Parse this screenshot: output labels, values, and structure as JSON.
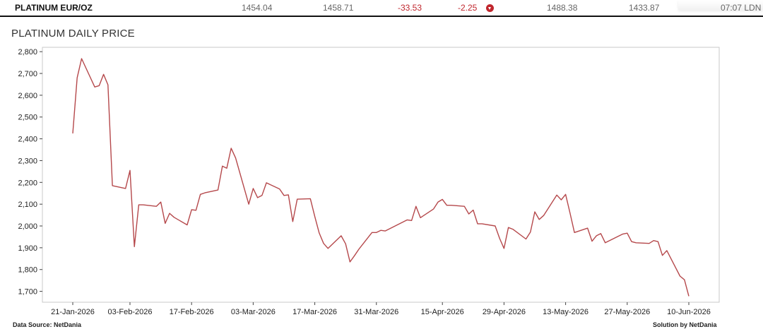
{
  "quote": {
    "name": "PLATINUM EUR/OZ",
    "last": "1454.04",
    "prev": "1458.71",
    "change": "-33.53",
    "change_pct": "-2.25",
    "direction_icon": "down-arrow-icon",
    "high": "1488.38",
    "low": "1433.87",
    "time": "07:07 LDN"
  },
  "chart_data": {
    "type": "line",
    "title": "PLATINUM DAILY PRICE",
    "xlabel": "",
    "ylabel": "",
    "ylim": [
      1650,
      2820
    ],
    "yticks": [
      1700,
      1800,
      1900,
      2000,
      2100,
      2200,
      2300,
      2400,
      2500,
      2600,
      2700,
      2800
    ],
    "ytick_labels": [
      "1,700",
      "1,800",
      "1,900",
      "2,000",
      "2,100",
      "2,200",
      "2,300",
      "2,400",
      "2,500",
      "2,600",
      "2,700",
      "2,800"
    ],
    "xtick_labels": [
      "21-Jan-2026",
      "03-Feb-2026",
      "17-Feb-2026",
      "03-Mar-2026",
      "17-Mar-2026",
      "31-Mar-2026",
      "15-Apr-2026",
      "29-Apr-2026",
      "13-May-2026",
      "27-May-2026",
      "10-Jun-2026"
    ],
    "grid": false,
    "line_color": "#b5484b",
    "series": [
      {
        "x": [
          "2026-01-21",
          "2026-01-22",
          "2026-01-23",
          "2026-01-26",
          "2026-01-27",
          "2026-01-28",
          "2026-01-29",
          "2026-01-30",
          "2026-02-02",
          "2026-02-03",
          "2026-02-04",
          "2026-02-05",
          "2026-02-06",
          "2026-02-09",
          "2026-02-10",
          "2026-02-11",
          "2026-02-12",
          "2026-02-13",
          "2026-02-16",
          "2026-02-17",
          "2026-02-18",
          "2026-02-19",
          "2026-02-20",
          "2026-02-23",
          "2026-02-24",
          "2026-02-25",
          "2026-02-26",
          "2026-02-27",
          "2026-03-02",
          "2026-03-03",
          "2026-03-04",
          "2026-03-05",
          "2026-03-06",
          "2026-03-09",
          "2026-03-10",
          "2026-03-11",
          "2026-03-12",
          "2026-03-13",
          "2026-03-16",
          "2026-03-17",
          "2026-03-18",
          "2026-03-19",
          "2026-03-20",
          "2026-03-23",
          "2026-03-24",
          "2026-03-25",
          "2026-03-26",
          "2026-03-27",
          "2026-03-30",
          "2026-03-31",
          "2026-04-01",
          "2026-04-02",
          "2026-04-07",
          "2026-04-08",
          "2026-04-09",
          "2026-04-10",
          "2026-04-13",
          "2026-04-14",
          "2026-04-15",
          "2026-04-16",
          "2026-04-17",
          "2026-04-20",
          "2026-04-21",
          "2026-04-22",
          "2026-04-23",
          "2026-04-24",
          "2026-04-27",
          "2026-04-28",
          "2026-04-29",
          "2026-04-30",
          "2026-05-01",
          "2026-05-04",
          "2026-05-05",
          "2026-05-06",
          "2026-05-07",
          "2026-05-08",
          "2026-05-11",
          "2026-05-12",
          "2026-05-13",
          "2026-05-14",
          "2026-05-15",
          "2026-05-18",
          "2026-05-19",
          "2026-05-20",
          "2026-05-21",
          "2026-05-22",
          "2026-05-26",
          "2026-05-27",
          "2026-05-28",
          "2026-05-29",
          "2026-06-01",
          "2026-06-02",
          "2026-06-03",
          "2026-06-04",
          "2026-06-05",
          "2026-06-08",
          "2026-06-09",
          "2026-06-10"
        ],
        "values": [
          2425,
          2680,
          2768,
          2638,
          2644,
          2696,
          2648,
          2185,
          2172,
          2255,
          1905,
          2097,
          2097,
          2090,
          2110,
          2012,
          2058,
          2040,
          2005,
          2075,
          2072,
          2145,
          2152,
          2165,
          2275,
          2265,
          2357,
          2312,
          2100,
          2172,
          2130,
          2140,
          2198,
          2170,
          2140,
          2143,
          2020,
          2123,
          2125,
          2043,
          1968,
          1920,
          1897,
          1955,
          1918,
          1835,
          1863,
          1893,
          1970,
          1970,
          1980,
          1977,
          2028,
          2025,
          2090,
          2038,
          2078,
          2110,
          2122,
          2095,
          2095,
          2090,
          2055,
          2073,
          2010,
          2010,
          2000,
          1943,
          1897,
          1993,
          1985,
          1940,
          1972,
          2065,
          2030,
          2048,
          2142,
          2120,
          2145,
          2060,
          1970,
          1990,
          1930,
          1955,
          1965,
          1923,
          1963,
          1967,
          1928,
          1923,
          1920,
          1933,
          1928,
          1865,
          1887,
          1770,
          1753,
          1678
        ]
      }
    ],
    "footer_left": "Data Source: NetDania",
    "footer_right": "Solution by NetDania"
  }
}
